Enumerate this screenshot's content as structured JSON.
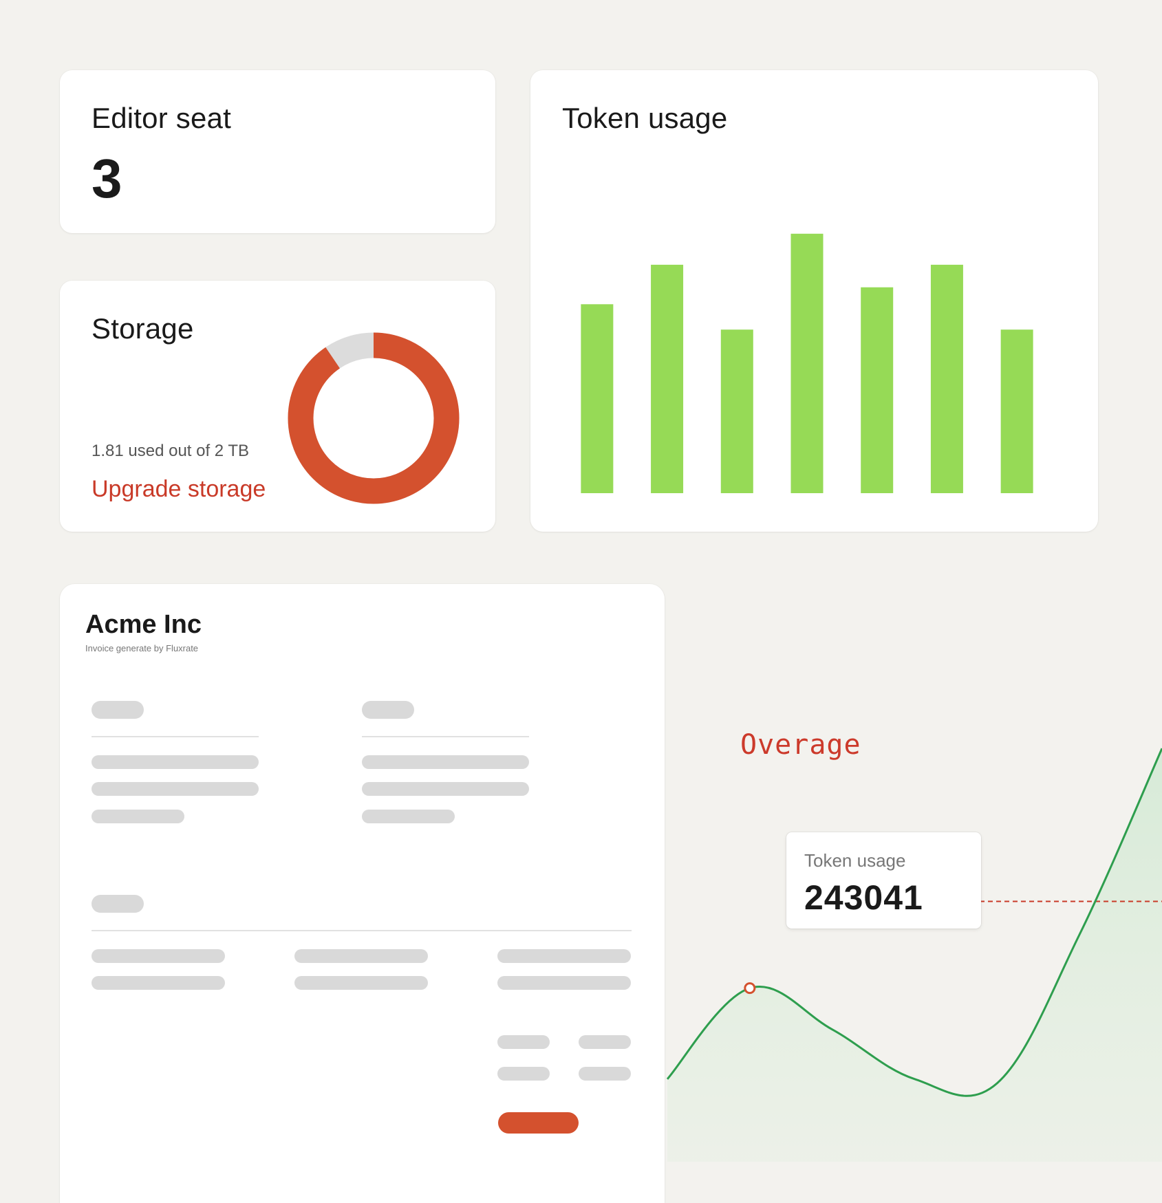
{
  "colors": {
    "background": "#f3f2ee",
    "bar_green": "#96da56",
    "donut_used": "#d4512e",
    "donut_free": "#dcdcdc",
    "accent_red": "#c93a28",
    "line_green": "#2e9e4e",
    "area_green": "#d5ead6",
    "skeleton": "#d9d9d9"
  },
  "seat_card": {
    "title": "Editor seat",
    "value": "3"
  },
  "storage_card": {
    "title": "Storage",
    "used_text": "1.81 used out of 2 TB",
    "upgrade_label": "Upgrade storage",
    "used": 1.81,
    "total": 2
  },
  "token_card": {
    "title": "Token usage"
  },
  "chart_data": [
    {
      "type": "bar",
      "title": "Token usage",
      "categories": [
        "",
        "",
        "",
        "",
        "",
        "",
        ""
      ],
      "values": [
        67,
        81,
        58,
        92,
        73,
        81,
        58
      ],
      "ylim": [
        0,
        100
      ],
      "grid": false,
      "legend": "none",
      "color": "#96da56"
    },
    {
      "type": "area",
      "x": [
        0,
        1,
        2,
        3,
        4,
        5,
        6
      ],
      "values": [
        20,
        42,
        32,
        20,
        19,
        55,
        100
      ],
      "ylim": [
        0,
        120
      ],
      "threshold": 63,
      "threshold_label": "Overage",
      "highlight_index": 1,
      "grid": false,
      "legend": "none"
    }
  ],
  "invoice": {
    "company": "Acme Inc",
    "subtitle": "Invoice generate by Fluxrate"
  },
  "overage": {
    "label": "Overage"
  },
  "tooltip": {
    "label": "Token usage",
    "value": "243041"
  }
}
